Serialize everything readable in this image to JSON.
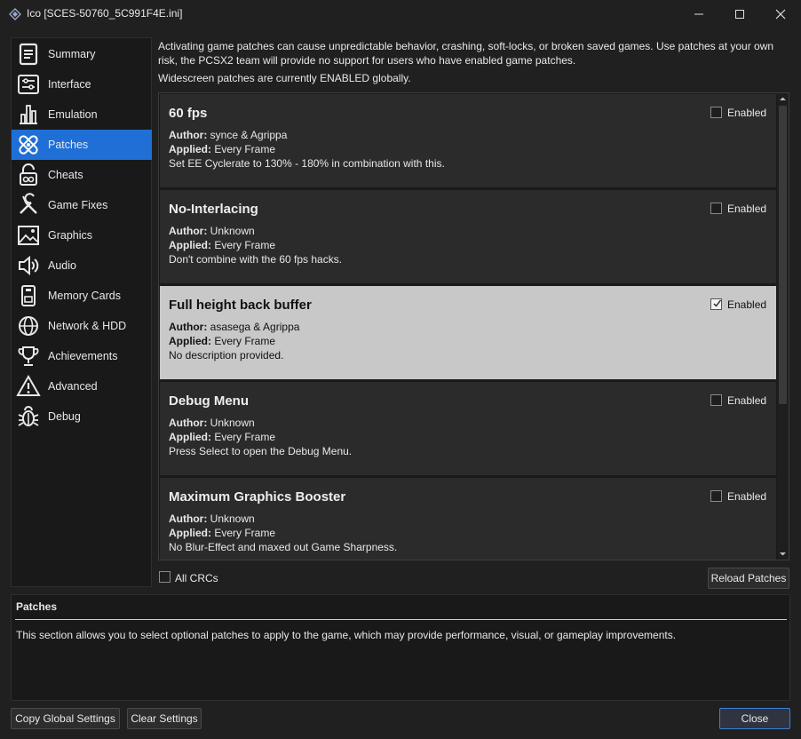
{
  "window": {
    "title": "Ico [SCES-50760_5C991F4E.ini]",
    "icon": "pcsx2-logo-icon"
  },
  "sidebar": {
    "items": [
      {
        "label": "Summary",
        "icon": "summary-icon"
      },
      {
        "label": "Interface",
        "icon": "interface-icon"
      },
      {
        "label": "Emulation",
        "icon": "emulation-icon"
      },
      {
        "label": "Patches",
        "icon": "bandage-icon",
        "active": true
      },
      {
        "label": "Cheats",
        "icon": "cheats-icon"
      },
      {
        "label": "Game Fixes",
        "icon": "tools-icon"
      },
      {
        "label": "Graphics",
        "icon": "image-icon"
      },
      {
        "label": "Audio",
        "icon": "speaker-icon"
      },
      {
        "label": "Memory Cards",
        "icon": "memory-card-icon"
      },
      {
        "label": "Network & HDD",
        "icon": "globe-icon"
      },
      {
        "label": "Achievements",
        "icon": "trophy-icon"
      },
      {
        "label": "Advanced",
        "icon": "warning-icon"
      },
      {
        "label": "Debug",
        "icon": "bug-icon"
      }
    ]
  },
  "main": {
    "warning": "Activating game patches can cause unpredictable behavior, crashing, soft-locks, or broken saved games. Use patches at your own risk, the PCSX2 team will provide no support for users who have enabled game patches.",
    "widescreen_status": "Widescreen patches are currently ENABLED globally.",
    "author_label": "Author:",
    "applied_label": "Applied:",
    "enabled_label": "Enabled",
    "patches": [
      {
        "name": "60 fps",
        "author": "synce & Agrippa",
        "applied": "Every Frame",
        "description": "Set EE Cyclerate to 130% - 180% in combination with this.",
        "enabled": false
      },
      {
        "name": "No-Interlacing",
        "author": "Unknown",
        "applied": "Every Frame",
        "description": "Don't combine with the 60 fps hacks.",
        "enabled": false
      },
      {
        "name": "Full height back buffer",
        "author": "asasega & Agrippa",
        "applied": "Every Frame",
        "description": "No description provided.",
        "enabled": true,
        "selected": true
      },
      {
        "name": "Debug Menu",
        "author": "Unknown",
        "applied": "Every Frame",
        "description": "Press Select to open the Debug Menu.",
        "enabled": false
      },
      {
        "name": "Maximum Graphics Booster",
        "author": "Unknown",
        "applied": "Every Frame",
        "description": "No Blur-Effect and maxed out Game Sharpness.",
        "enabled": false
      }
    ],
    "all_crcs_label": "All CRCs",
    "reload_label": "Reload Patches"
  },
  "help": {
    "title": "Patches",
    "text": "This section allows you to select optional patches to apply to the game, which may provide performance, visual, or gameplay improvements."
  },
  "footer": {
    "copy_label": "Copy Global Settings",
    "clear_label": "Clear Settings",
    "close_label": "Close"
  },
  "colors": {
    "accent": "#1f6fd6",
    "selected_row": "#c8c8c8",
    "background": "#202020"
  }
}
